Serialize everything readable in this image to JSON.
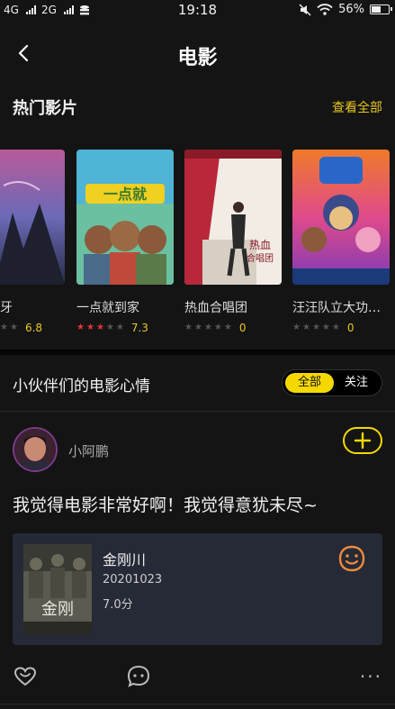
{
  "status_bar": {
    "network_1": "4G",
    "network_2": "2G",
    "time": "19:18",
    "battery": "56%",
    "battery_level": 0.56
  },
  "nav": {
    "title": "电影"
  },
  "hot": {
    "title": "热门影片",
    "see_all": "查看全部",
    "movies": [
      {
        "name": "牙",
        "score": "6.8",
        "stars": 0,
        "poster": "poster-1"
      },
      {
        "name": "一点就到家",
        "score": "7.3",
        "stars": 3,
        "poster": "poster-2"
      },
      {
        "name": "热血合唱团",
        "score": "0",
        "stars": 0,
        "poster": "poster-3"
      },
      {
        "name": "汪汪队立大功…",
        "score": "0",
        "stars": 0,
        "poster": "poster-4"
      }
    ]
  },
  "mood": {
    "title": "小伙伴们的电影心情",
    "toggle_all": "全部",
    "toggle_follow": "关注"
  },
  "post": {
    "user_name": "小阿鹏",
    "follow_icon": "plus-icon",
    "text": "我觉得电影非常好啊！我觉得意犹未尽~",
    "movie": {
      "name": "金刚川",
      "date": "20201023",
      "score": "7.0分",
      "mood_icon": "smile-face-icon"
    },
    "actions": {
      "like_icon": "heart-icon",
      "comment_icon": "comment-icon",
      "more_icon": "more-icon",
      "more_glyph": "···"
    }
  },
  "colors": {
    "accent": "#f5d800",
    "star_on": "#e8323a",
    "score": "#e8c820",
    "card_bg": "#262a36",
    "mood_orange": "#f08a3c"
  }
}
